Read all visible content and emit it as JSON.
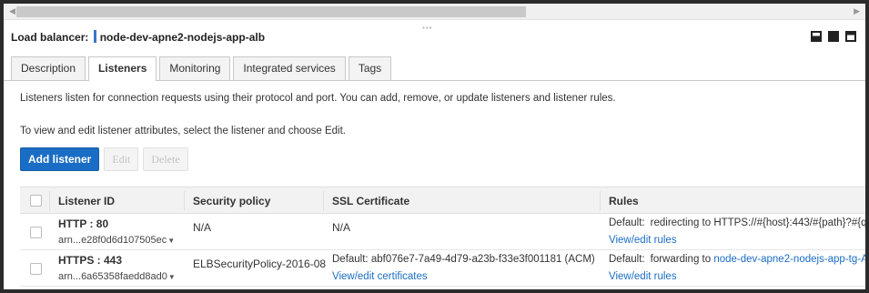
{
  "load_balancer": {
    "label": "Load balancer:",
    "name": "node-dev-apne2-nodejs-app-alb"
  },
  "tabs": [
    {
      "label": "Description",
      "active": false
    },
    {
      "label": "Listeners",
      "active": true
    },
    {
      "label": "Monitoring",
      "active": false
    },
    {
      "label": "Integrated services",
      "active": false
    },
    {
      "label": "Tags",
      "active": false
    }
  ],
  "info": {
    "line1": "Listeners listen for connection requests using their protocol and port. You can add, remove, or update listeners and listener rules.",
    "line2": "To view and edit listener attributes, select the listener and choose Edit."
  },
  "buttons": {
    "add": "Add listener",
    "edit": "Edit",
    "delete": "Delete"
  },
  "table": {
    "columns": [
      "Listener ID",
      "Security policy",
      "SSL Certificate",
      "Rules"
    ],
    "rows": [
      {
        "protocol": "HTTP : 80",
        "arn": "arn...e28f0d6d107505ec",
        "security_policy": "N/A",
        "ssl_certificate": "N/A",
        "ssl_link": "",
        "rule_label": "Default:",
        "rule_text": "redirecting to HTTPS://#{host}:443/#{path}?#{q",
        "rule_target": "",
        "rule_link": "View/edit rules"
      },
      {
        "protocol": "HTTPS : 443",
        "arn": "arn...6a65358faedd8ad0",
        "security_policy": "ELBSecurityPolicy-2016-08",
        "ssl_certificate": "Default:  abf076e7-7a49-4d79-a23b-f33e3f001181 (ACM)",
        "ssl_link": "View/edit certificates",
        "rule_label": "Default:",
        "rule_text": "forwarding to ",
        "rule_target": "node-dev-apne2-nodejs-app-tg-A",
        "rule_link": "View/edit rules"
      }
    ]
  },
  "colors": {
    "accent": "#1a6dc4",
    "lb_marker": "#3a76c9"
  }
}
